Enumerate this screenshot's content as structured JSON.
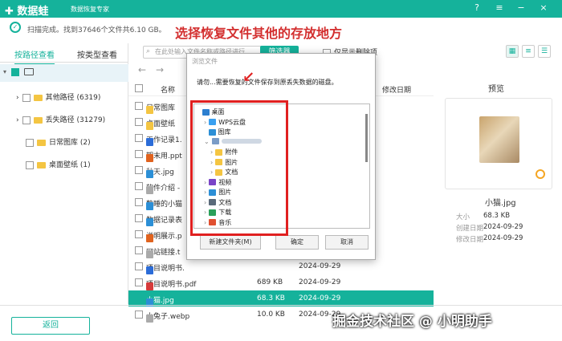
{
  "app": {
    "logo": "✚ 数据蛙",
    "subtitle": "数据恢复专家"
  },
  "window_buttons": [
    "?",
    "≡",
    "−",
    "×"
  ],
  "scan_status": "扫描完成。找到37646个文件共6.10 GB。",
  "annotation_title": "选择恢复文件其他的存放地方",
  "left_tabs": [
    "按路径查看",
    "按类型查看"
  ],
  "tree": [
    {
      "label": "其他路径 (6319)"
    },
    {
      "label": "丢失路径 (31279)"
    },
    {
      "label": "日常图库 (2)"
    },
    {
      "label": "桌面壁纸 (1)"
    }
  ],
  "toolbar": {
    "search_placeholder": "在此处输入文件名称或路径进行",
    "filter_label": "筛选器",
    "only_deleted_label": "仅显示删除项"
  },
  "file_header": {
    "name": "名称",
    "modified": "修改日期"
  },
  "files": [
    {
      "name": "日常图库",
      "size": "",
      "date": "2024-09-29",
      "color": "#f4c542"
    },
    {
      "name": "桌面壁纸",
      "size": "",
      "date": "2024-09-29",
      "color": "#f4c542"
    },
    {
      "name": "工作记录1.",
      "size": "",
      "date": "2024-09-11",
      "color": "#2b6cd8"
    },
    {
      "name": "期末用.ppt",
      "size": "",
      "date": "2024-09-29",
      "color": "#e0631f"
    },
    {
      "name": "秋天.jpg",
      "size": "",
      "date": "2024-09-29",
      "color": "#2c8fd6"
    },
    {
      "name": "软件介绍 -",
      "size": "",
      "date": "2024-09-29",
      "color": "#aaaaaa"
    },
    {
      "name": "熟睡的小猫",
      "size": "",
      "date": "2024-09-29",
      "color": "#2c8fd6"
    },
    {
      "name": "数据记录表",
      "size": "",
      "date": "2024-09-29",
      "color": "#2c8fd6"
    },
    {
      "name": "说明展示.p",
      "size": "",
      "date": "2024-09-29",
      "color": "#e0631f"
    },
    {
      "name": "网站链接.t",
      "size": "",
      "date": "2024-09-29",
      "color": "#aaaaaa"
    },
    {
      "name": "项目说明书.",
      "size": "",
      "date": "2024-09-29",
      "color": "#2b6cd8"
    },
    {
      "name": "项目说明书.pdf",
      "size": "689 KB",
      "date": "2024-09-29",
      "color": "#d63b3b"
    },
    {
      "name": "小猫.jpg",
      "size": "68.3 KB",
      "date": "2024-09-29",
      "color": "#2c8fd6",
      "selected": true
    },
    {
      "name": "小兔子.webp",
      "size": "10.0 KB",
      "date": "2024-09-29",
      "color": "#aaaaaa"
    }
  ],
  "preview": {
    "title": "预览",
    "filename": "小猫.jpg",
    "meta": [
      {
        "k": "大小",
        "v": "68.3 KB"
      },
      {
        "k": "创建日期",
        "v": "2024-09-29"
      },
      {
        "k": "修改日期",
        "v": "2024-09-29"
      }
    ]
  },
  "dialog": {
    "title": "浏览文件",
    "message": "请勿...需要恢复的文件保存到原丢失数据的磁盘。",
    "tree": [
      {
        "label": "桌面",
        "depth": 0,
        "arrow": "",
        "color": "#2c7fd0"
      },
      {
        "label": "WPS云盘",
        "depth": 1,
        "arrow": "›",
        "color": "#3aa0f0"
      },
      {
        "label": "图库",
        "depth": 1,
        "arrow": "",
        "color": "#2c8fd6"
      },
      {
        "label": "",
        "depth": 1,
        "arrow": "⌄",
        "color": "#7a9cc7"
      },
      {
        "label": "附件",
        "depth": 2,
        "arrow": "›",
        "color": "#f4c542"
      },
      {
        "label": "图片",
        "depth": 2,
        "arrow": "›",
        "color": "#f4c542"
      },
      {
        "label": "文档",
        "depth": 2,
        "arrow": "›",
        "color": "#f4c542"
      },
      {
        "label": "视频",
        "depth": 1,
        "arrow": "›",
        "color": "#7a44c7"
      },
      {
        "label": "图片",
        "depth": 1,
        "arrow": "›",
        "color": "#2c8fd6"
      },
      {
        "label": "文档",
        "depth": 1,
        "arrow": "›",
        "color": "#5a6a7a"
      },
      {
        "label": "下载",
        "depth": 1,
        "arrow": "›",
        "color": "#2aa05a"
      },
      {
        "label": "音乐",
        "depth": 1,
        "arrow": "›",
        "color": "#e05030"
      }
    ],
    "buttons": [
      "新建文件夹(M)",
      "确定",
      "取消"
    ]
  },
  "back_button": "返回",
  "watermark": "掘金技术社区 @ 小明助手"
}
